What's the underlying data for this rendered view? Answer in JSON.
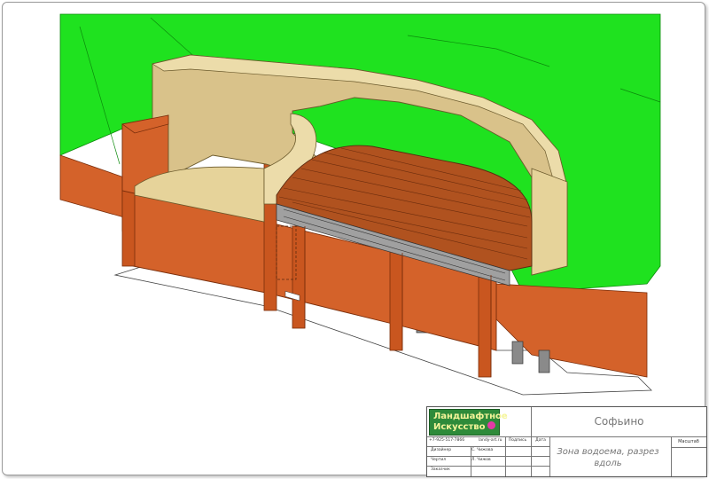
{
  "colors": {
    "grass": "#1fe21f",
    "brick": "#d4622a",
    "brick_dark": "#a94817",
    "wall_inner": "#d9c28a",
    "wall_top": "#ecdcaa",
    "deck": "#b0521f",
    "post": "#8a8a8a"
  },
  "title_block": {
    "logo_line1": "Ландшафтное",
    "logo_line2": "Искусство",
    "phone": "+7-925-517-7866",
    "site": "landy-art.ru",
    "col_signature": "Подпись",
    "col_date": "Дата",
    "row_designer": "Дизайнер",
    "row_drawer": "Чертил",
    "row_customer": "Заказчик",
    "designer_name": "С. Чижова",
    "drawer_name": "Л. Чижов",
    "project": "Софьино",
    "sheet_title": "Зона водоема, разрез вдоль",
    "scale_label": "Масштаб"
  }
}
